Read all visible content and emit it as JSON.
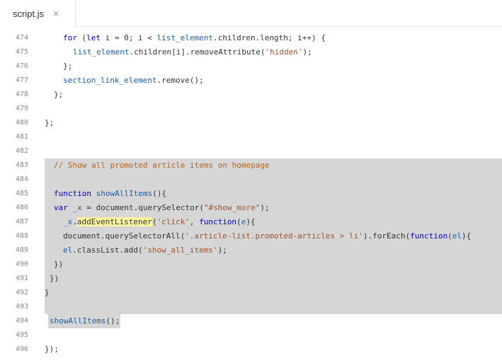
{
  "tab": {
    "label": "script.js",
    "close_glyph": "×"
  },
  "lines": [
    {
      "num": "474",
      "indent": 89,
      "tokens": [
        {
          "t": "for",
          "c": "kw"
        },
        {
          "t": " (",
          "c": "id"
        },
        {
          "t": "let",
          "c": "kw"
        },
        {
          "t": " i = 0; i < ",
          "c": "id"
        },
        {
          "t": "list_element",
          "c": "var"
        },
        {
          "t": ".children.length; i++) {",
          "c": "id"
        }
      ]
    },
    {
      "num": "475",
      "indent": 103,
      "tokens": [
        {
          "t": "list_element",
          "c": "var"
        },
        {
          "t": ".children[i].removeAttribute(",
          "c": "id"
        },
        {
          "t": "'hidden'",
          "c": "str"
        },
        {
          "t": ");",
          "c": "id"
        }
      ]
    },
    {
      "num": "476",
      "indent": 89,
      "tokens": [
        {
          "t": "};",
          "c": "id"
        }
      ]
    },
    {
      "num": "477",
      "indent": 89,
      "tokens": [
        {
          "t": "section_link_element",
          "c": "var"
        },
        {
          "t": ".remove();",
          "c": "id"
        }
      ]
    },
    {
      "num": "478",
      "indent": 76,
      "tokens": [
        {
          "t": "};",
          "c": "id"
        }
      ]
    },
    {
      "num": "479",
      "indent": 63,
      "tokens": []
    },
    {
      "num": "480",
      "indent": 63,
      "tokens": [
        {
          "t": "};",
          "c": "id"
        }
      ]
    },
    {
      "num": "481",
      "indent": 63,
      "tokens": []
    },
    {
      "num": "482",
      "indent": 63,
      "tokens": []
    },
    {
      "num": "483",
      "indent": 76,
      "tokens": [
        {
          "t": "// Show all promoted article items on homepage",
          "c": "cmt"
        }
      ]
    },
    {
      "num": "484",
      "indent": 63,
      "tokens": []
    },
    {
      "num": "485",
      "indent": 76,
      "tokens": [
        {
          "t": "function",
          "c": "kw"
        },
        {
          "t": " ",
          "c": "id"
        },
        {
          "t": "showAllItems",
          "c": "fn"
        },
        {
          "t": "(){",
          "c": "id"
        }
      ]
    },
    {
      "num": "486",
      "indent": 76,
      "tokens": [
        {
          "t": "var",
          "c": "kw"
        },
        {
          "t": " ",
          "c": "id"
        },
        {
          "t": "_x",
          "c": "var"
        },
        {
          "t": " = document.querySelector(",
          "c": "id"
        },
        {
          "t": "\"#show_more\"",
          "c": "str"
        },
        {
          "t": ");",
          "c": "id"
        }
      ]
    },
    {
      "num": "487",
      "indent": 89,
      "tokens": [
        {
          "t": "_x",
          "c": "var"
        },
        {
          "t": ".",
          "c": "id"
        },
        {
          "t": "addEventListener",
          "c": "hl"
        },
        {
          "t": "(",
          "c": "id"
        },
        {
          "t": "'click'",
          "c": "str"
        },
        {
          "t": ", ",
          "c": "id"
        },
        {
          "t": "function",
          "c": "kw"
        },
        {
          "t": "(",
          "c": "id"
        },
        {
          "t": "e",
          "c": "var"
        },
        {
          "t": "){",
          "c": "id"
        }
      ]
    },
    {
      "num": "488",
      "indent": 89,
      "tokens": [
        {
          "t": "document.querySelectorAll(",
          "c": "id"
        },
        {
          "t": "'.article-list.promoted-articles > li'",
          "c": "str"
        },
        {
          "t": ").forEach(",
          "c": "id"
        },
        {
          "t": "function",
          "c": "kw"
        },
        {
          "t": "(",
          "c": "id"
        },
        {
          "t": "el",
          "c": "var"
        },
        {
          "t": "){",
          "c": "id"
        }
      ]
    },
    {
      "num": "489",
      "indent": 89,
      "tokens": [
        {
          "t": "el",
          "c": "var"
        },
        {
          "t": ".classList.add(",
          "c": "id"
        },
        {
          "t": "'show_all_items'",
          "c": "str"
        },
        {
          "t": ");",
          "c": "id"
        }
      ]
    },
    {
      "num": "490",
      "indent": 76,
      "tokens": [
        {
          "t": "})",
          "c": "id"
        }
      ]
    },
    {
      "num": "491",
      "indent": 70,
      "tokens": [
        {
          "t": "})",
          "c": "id"
        }
      ]
    },
    {
      "num": "492",
      "indent": 63,
      "tokens": [
        {
          "t": "}",
          "c": "id"
        }
      ]
    },
    {
      "num": "493",
      "indent": 63,
      "tokens": []
    },
    {
      "num": "494",
      "indent": 70,
      "tokens": [
        {
          "t": "showAllItems",
          "c": "fn"
        },
        {
          "t": "();",
          "c": "id"
        }
      ]
    },
    {
      "num": "495",
      "indent": 63,
      "tokens": []
    },
    {
      "num": "496",
      "indent": 63,
      "tokens": [
        {
          "t": "});",
          "c": "id"
        }
      ]
    }
  ]
}
